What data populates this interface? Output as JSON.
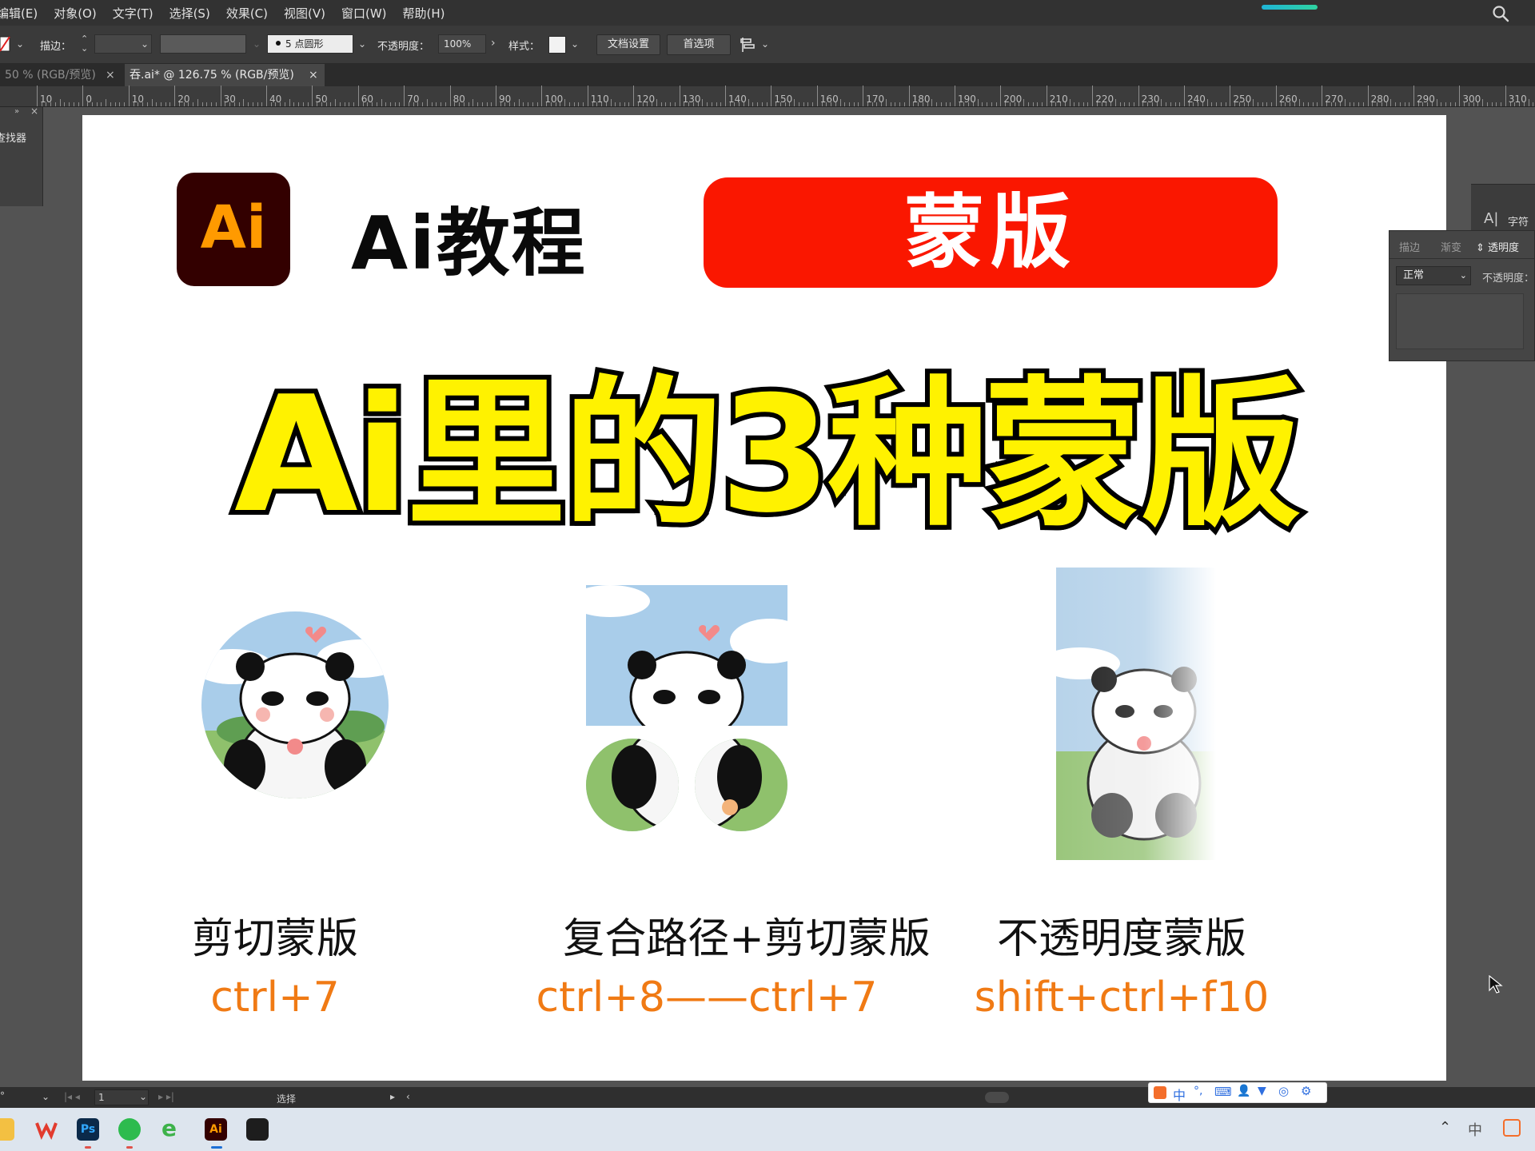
{
  "menubar": {
    "items": [
      "编辑(E)",
      "对象(O)",
      "文字(T)",
      "选择(S)",
      "效果(C)",
      "视图(V)",
      "窗口(W)",
      "帮助(H)"
    ]
  },
  "control_bar": {
    "stroke_label": "描边：",
    "brush_value": "5 点圆形",
    "opacity_label": "不透明度：",
    "opacity_value": "100%",
    "style_label": "样式：",
    "doc_setup_label": "文档设置",
    "prefs_label": "首选项"
  },
  "tabs": [
    {
      "label": "50 % (RGB/预览)",
      "active": false
    },
    {
      "label": "吞.ai* @ 126.75 % (RGB/预览)",
      "active": true
    }
  ],
  "ruler": {
    "labels": [
      "10",
      "0",
      "10",
      "20",
      "30",
      "40",
      "50",
      "60",
      "70",
      "80",
      "90",
      "100",
      "110",
      "120",
      "130",
      "140",
      "150",
      "160",
      "170",
      "180",
      "190",
      "200",
      "210",
      "220",
      "230",
      "240",
      "250",
      "260",
      "270",
      "280",
      "290",
      "300",
      "310"
    ]
  },
  "left_panel": {
    "title": "查找器"
  },
  "artboard": {
    "logo_text": "Ai",
    "tutorial_title": "Ai教程",
    "topic_badge": "蒙版",
    "headline": "Ai里的3种蒙版",
    "examples": [
      {
        "caption": "剪切蒙版",
        "shortcut": "ctrl+7"
      },
      {
        "caption": "复合路径+剪切蒙版",
        "shortcut": "ctrl+8——ctrl+7"
      },
      {
        "caption": "不透明度蒙版",
        "shortcut": "shift+ctrl+f10"
      }
    ]
  },
  "right_panel": {
    "char_tab": "字符",
    "tabs": [
      "描边",
      "渐变",
      "透明度"
    ],
    "blend_mode": "正常",
    "opacity_label": "不透明度："
  },
  "status_bar": {
    "page_value": "1",
    "tool_label": "选择"
  },
  "ime": {
    "mode": "中"
  },
  "taskbar": {
    "ps_label": "Ps",
    "ai_label": "Ai",
    "lang": "中"
  },
  "colors": {
    "accent_red": "#fa1700",
    "headline_yellow": "#fff200",
    "shortcut_orange": "#f07a14",
    "ai_brand_bg": "#330000",
    "ai_brand_fg": "#ff9a00"
  }
}
